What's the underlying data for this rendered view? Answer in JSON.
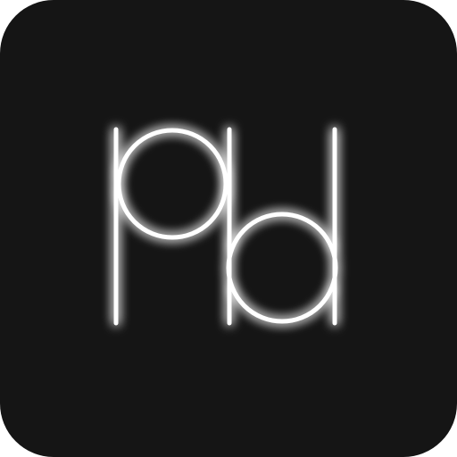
{
  "app_icon": {
    "name": "app-logo-icon",
    "background_color": "#151515",
    "glyph_color": "#ffffff",
    "glow_color": "#ffffff",
    "logo_text": "Pd"
  }
}
